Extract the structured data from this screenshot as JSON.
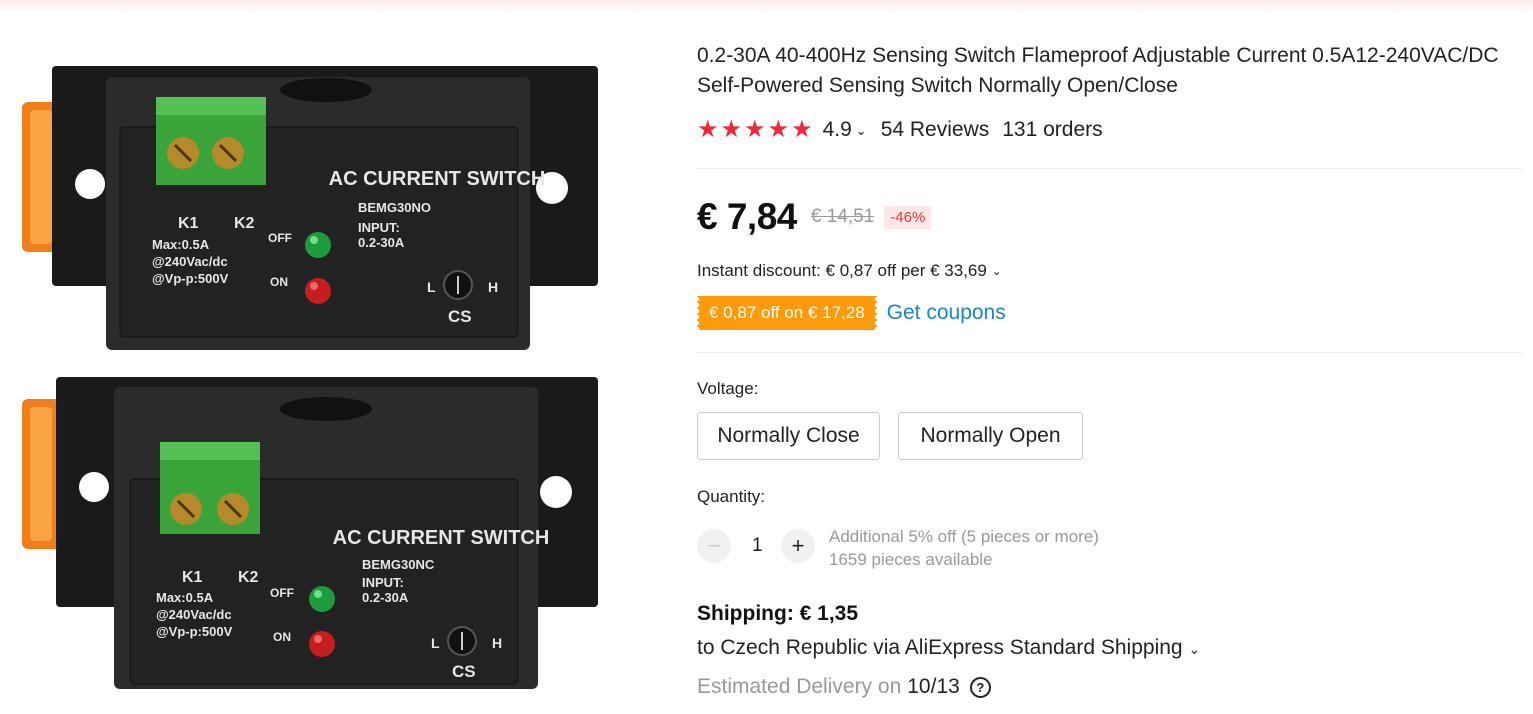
{
  "gallery": {
    "images": [
      {
        "heading": "AC CURRENT SWITCH",
        "model": "BEMG30NO",
        "input_label": "INPUT:",
        "input_value": "0.2-30A",
        "k1": "K1",
        "k2": "K2",
        "spec1": "Max:0.5A",
        "spec2": "@240Vac/dc",
        "spec3": "@Vp-p:500V",
        "off": "OFF",
        "on": "ON",
        "low": "L",
        "high": "H",
        "cs": "CS"
      },
      {
        "heading": "AC CURRENT SWITCH",
        "model": "BEMG30NC",
        "input_label": "INPUT:",
        "input_value": "0.2-30A",
        "k1": "K1",
        "k2": "K2",
        "spec1": "Max:0.5A",
        "spec2": "@240Vac/dc",
        "spec3": "@Vp-p:500V",
        "off": "OFF",
        "on": "ON",
        "low": "L",
        "high": "H",
        "cs": "CS"
      }
    ]
  },
  "product": {
    "title": "0.2-30A 40-400Hz Sensing Switch Flameproof Adjustable Current 0.5A12-240VAC/DC Self-Powered Sensing Switch Normally Open/Close",
    "rating": {
      "stars": 5,
      "score": "4.9",
      "reviews": "54 Reviews",
      "orders": "131 orders"
    },
    "price": {
      "current": "€ 7,84",
      "original": "€ 14,51",
      "discount": "-46%"
    },
    "instant_discount": "Instant discount: € 0,87 off per € 33,69",
    "coupon": {
      "label": "€ 0,87 off on € 17,28",
      "link": "Get coupons"
    },
    "voltage": {
      "label": "Voltage:",
      "options": [
        "Normally Close",
        "Normally Open"
      ]
    },
    "quantity": {
      "label": "Quantity:",
      "minus": "−",
      "plus": "+",
      "value": "1",
      "note1": "Additional 5% off (5 pieces or more)",
      "note2": "1659 pieces available"
    },
    "shipping": {
      "cost": "Shipping: € 1,35",
      "via": "to Czech Republic via AliExpress Standard Shipping",
      "est_label": "Estimated Delivery on",
      "est_date": "10/13"
    }
  },
  "icons": {
    "rating_dropdown": "chevron-down-icon",
    "discount_dropdown": "chevron-down-icon",
    "shipping_dropdown": "chevron-down-icon",
    "help": "question-circle-icon"
  },
  "colors": {
    "star": "#ee2a3a",
    "coupon_bg": "#ff9a0c",
    "link": "#1b86c7",
    "discount_text": "#e9343d"
  }
}
